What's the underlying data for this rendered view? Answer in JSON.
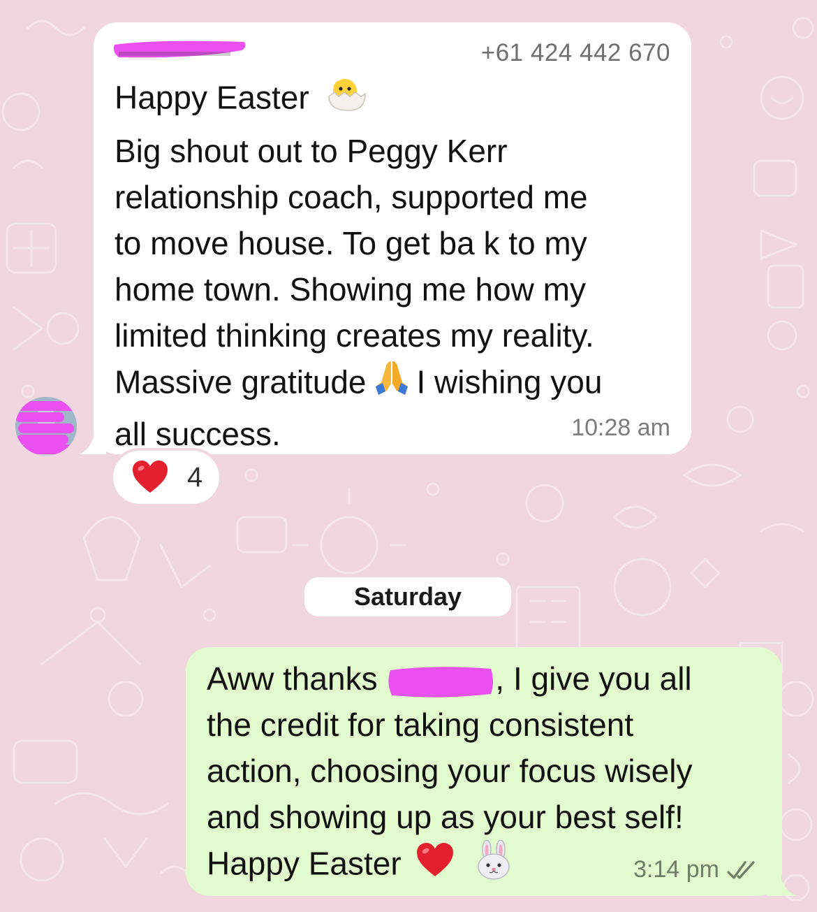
{
  "incoming": {
    "sender_phone": "+61 424 442 670",
    "lines": [
      "Happy Easter",
      "Big shout out to Peggy Kerr",
      "relationship coach, supported me",
      "to move house. To get ba k to my",
      "home town. Showing me how my",
      "limited thinking creates my reality.",
      "Massive gratitude",
      "I wishing you",
      "all success."
    ],
    "time": "10:28 am",
    "reaction": {
      "emoji": "heart",
      "count": "4"
    }
  },
  "date_separator": "Saturday",
  "outgoing": {
    "line1_before": "Aww thanks",
    "line1_after": ", I give you all",
    "lines": [
      "the credit for taking consistent",
      "action, choosing your focus wisely",
      "and showing up as your best self!",
      "Happy Easter"
    ],
    "time": "3:14 pm",
    "status": "read"
  },
  "colors": {
    "wallpaper": "#efd6df",
    "incoming_bubble": "#ffffff",
    "outgoing_bubble": "#e1fbcf",
    "redaction": "#ea4ff0",
    "read_ticks": "#6d7d66"
  },
  "icons": [
    "hatching-chick-icon",
    "folded-hands-icon",
    "red-heart-icon",
    "bunny-face-icon",
    "double-check-icon"
  ]
}
